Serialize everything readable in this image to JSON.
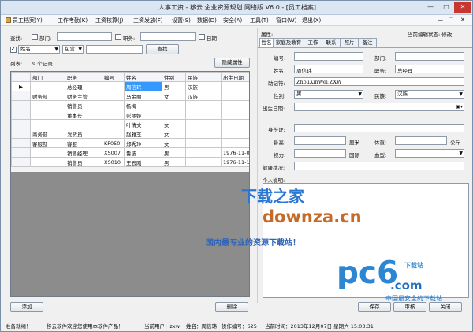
{
  "window": {
    "title": "人事工资 - 移云 企业资源规划 网络版 V6.0 - [员工档案]",
    "min": "—",
    "max": "□",
    "close": "✕"
  },
  "menu": [
    "员工档案(Y)",
    "工作考勤(K)",
    "工资核算(J)",
    "工资发放(F)",
    "设置(S)",
    "数据(D)",
    "安全(A)",
    "工具(T)",
    "窗口(W)",
    "退出(X)"
  ],
  "menu_right": {
    "min": "—",
    "restore": "❐",
    "close": "✕"
  },
  "search": {
    "label": "查找:",
    "dept_label": "部门:",
    "job_label": "职务:",
    "date_label": "日期",
    "field_value": "姓名",
    "match_value": "包含",
    "keyword_value": "",
    "find_button": "查找"
  },
  "list": {
    "label": "列表:",
    "count": "9 个记录",
    "hide_button": "隐藏属性",
    "columns": [
      "部门",
      "职务",
      "编号",
      "姓名",
      "性别",
      "民族",
      "出生日期"
    ],
    "rows": [
      [
        "",
        "总经理",
        "",
        "周信玮",
        "男",
        "汉族",
        ""
      ],
      [
        "财务部",
        "财务主管",
        "",
        "马金丽",
        "女",
        "汉族",
        ""
      ],
      [
        "",
        "销售员",
        "",
        "杨梅",
        "",
        "",
        ""
      ],
      [
        "",
        "董事长",
        "",
        "彭丽娅",
        "",
        "",
        ""
      ],
      [
        "",
        "",
        "",
        "叶倩文",
        "女",
        "",
        ""
      ],
      [
        "商务部",
        "发货员",
        "",
        "赵雅芝",
        "女",
        "",
        ""
      ],
      [
        "客服部",
        "客服",
        "KF050",
        "郑秀玲",
        "女",
        "",
        ""
      ],
      [
        "",
        "销售经理",
        "XS007",
        "鲁波",
        "男",
        "",
        "1976-11-07"
      ],
      [
        "",
        "销售员",
        "XS010",
        "王云刚",
        "男",
        "",
        "1976-11-18"
      ]
    ],
    "add_button": "添加",
    "delete_button": "删除"
  },
  "detail": {
    "attr_label": "属性:",
    "edit_status": "当前编辑状态: 修改",
    "tabs": [
      "姓名",
      "家庭及教育",
      "工作",
      "联系",
      "照片",
      "备注"
    ],
    "fields": {
      "code_label": "编号:",
      "code_value": "",
      "dept_label": "部门:",
      "dept_value": "",
      "name_label": "姓名",
      "name_value": "周信玮",
      "job_label": "职务:",
      "job_value": "总经理",
      "mnemonic_label": "助记符:",
      "mnemonic_value": "ZhouXinWei,ZXW",
      "gender_label": "性别:",
      "gender_value": "男",
      "ethnic_label": "民族:",
      "ethnic_value": "汉族",
      "birth_label": "出生日期:",
      "birth_value": "",
      "id_label": "身份证:",
      "id_value": "",
      "height_label": "身高:",
      "height_value": "",
      "height_unit": "厘米",
      "weight_label": "体重:",
      "weight_value": "",
      "weight_unit": "公斤",
      "vision_label": "视力:",
      "vision_value": "",
      "nation_label": "国际",
      "nation_value": "",
      "blood_label": "血型:",
      "blood_value": "",
      "health_label": "健康状况:",
      "health_value": "",
      "intro_label": "个人说明:"
    },
    "save_button": "保存",
    "audit_button": "审核",
    "close_button": "关闭"
  },
  "status": {
    "ready": "准备就绪！",
    "welcome": "移云软件欢迎您使用本软件产品！",
    "user": "当前用户：zxw",
    "name": "姓名：周信玮",
    "ops": "操作编号：625",
    "time": "当前时间：2013年12月07日 星期六 15:03:31"
  },
  "watermark": {
    "line1": "下载之家",
    "line2": "downza.cn",
    "line3": "国内最专业的资源下载站！",
    "line4": "pc6",
    "line5": "下载站",
    "line6": ".com",
    "line7": "中国最安全的下载站"
  },
  "colors": {
    "selection": "#3399ff",
    "close_button": "#c7372f"
  }
}
